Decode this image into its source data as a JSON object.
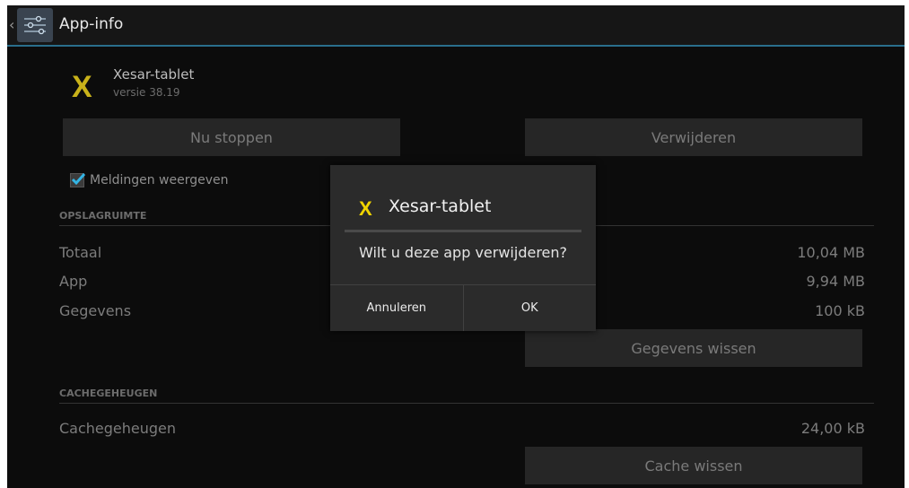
{
  "action_bar": {
    "title": "App-info",
    "up_caret": "‹"
  },
  "app": {
    "logo_letter": "X",
    "name": "Xesar-tablet",
    "version": "versie 38.19"
  },
  "buttons": {
    "force_stop": "Nu stoppen",
    "uninstall": "Verwijderen",
    "clear_data": "Gegevens wissen",
    "clear_cache": "Cache wissen"
  },
  "notifications": {
    "label": "Meldingen weergeven",
    "checked": true
  },
  "storage": {
    "header": "OPSLAGRUIMTE",
    "rows": [
      {
        "label": "Totaal",
        "value": "10,04 MB"
      },
      {
        "label": "App",
        "value": "9,94 MB"
      },
      {
        "label": "Gegevens",
        "value": "100 kB"
      }
    ]
  },
  "cache": {
    "header": "CACHEGEHEUGEN",
    "row": {
      "label": "Cachegeheugen",
      "value": "24,00 kB"
    }
  },
  "dialog": {
    "logo_letter": "X",
    "title": "Xesar-tablet",
    "message": "Wilt u deze app verwijderen?",
    "cancel": "Annuleren",
    "ok": "OK"
  },
  "colors": {
    "accent": "#2a6f8c",
    "logo_yellow": "#f0d400",
    "check_blue": "#33b5e5"
  }
}
